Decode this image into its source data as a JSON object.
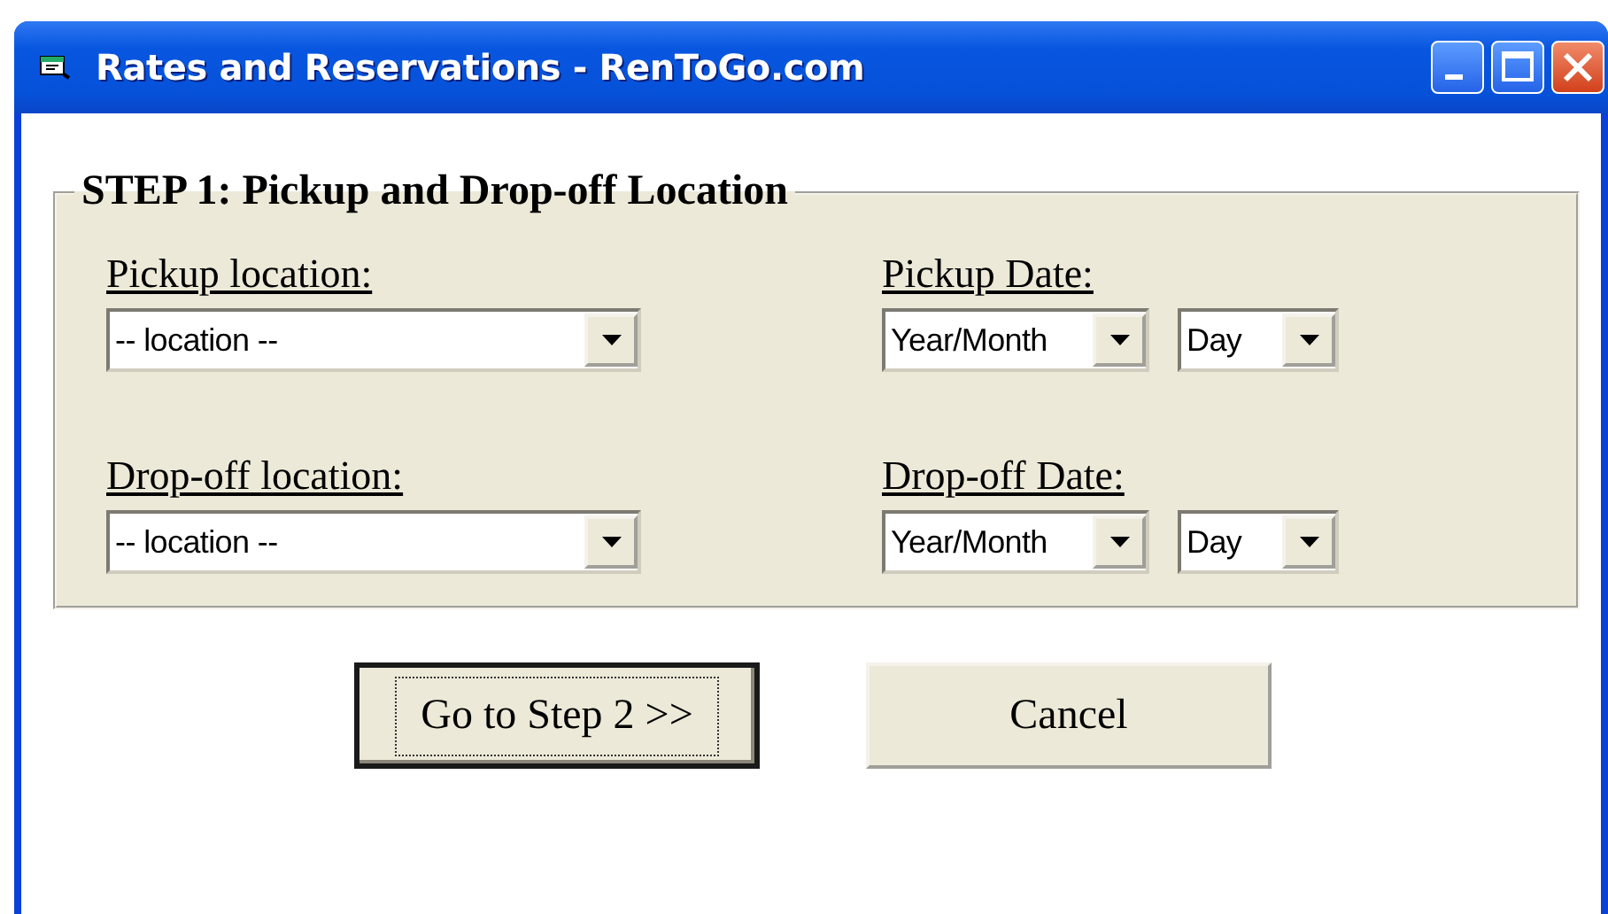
{
  "window": {
    "title": "Rates and Reservations - RenToGo.com"
  },
  "group": {
    "title": "STEP 1: Pickup and Drop-off Location",
    "fields": [
      {
        "label": "Pickup location:",
        "dropdowns": [
          {
            "kind": "location",
            "value": "-- location --"
          }
        ]
      },
      {
        "label": "Pickup Date:",
        "dropdowns": [
          {
            "kind": "month",
            "value": "Year/Month"
          },
          {
            "kind": "day",
            "value": "Day"
          }
        ]
      },
      {
        "label": "Drop-off location:",
        "dropdowns": [
          {
            "kind": "location",
            "value": "-- location --"
          }
        ]
      },
      {
        "label": "Drop-off Date:",
        "dropdowns": [
          {
            "kind": "month",
            "value": "Year/Month"
          },
          {
            "kind": "day",
            "value": "Day"
          }
        ]
      }
    ]
  },
  "buttons": [
    {
      "label": "Go to Step 2 >>",
      "focused": true
    },
    {
      "label": "Cancel",
      "focused": false
    }
  ]
}
